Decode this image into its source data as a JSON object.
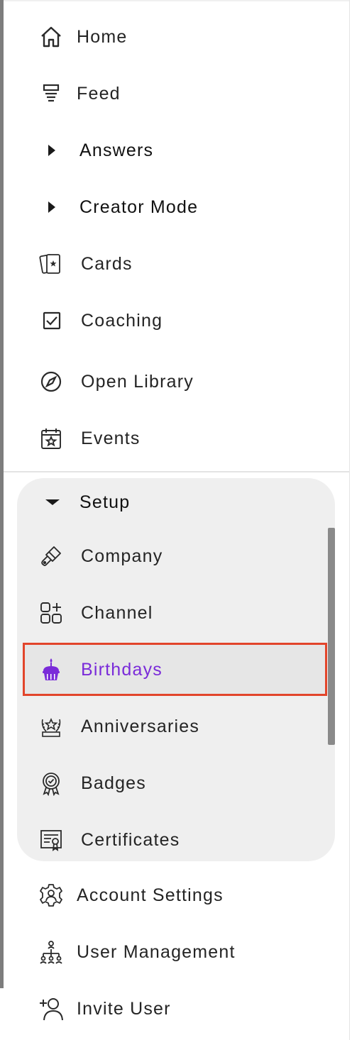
{
  "nav": {
    "home": {
      "label": "Home",
      "icon": "home-icon"
    },
    "feed": {
      "label": "Feed",
      "icon": "feed-icon"
    },
    "answers": {
      "label": "Answers",
      "icon": "caret-right-icon"
    },
    "creator_mode": {
      "label": "Creator Mode",
      "icon": "caret-right-icon"
    },
    "cards": {
      "label": "Cards",
      "icon": "cards-icon"
    },
    "coaching": {
      "label": "Coaching",
      "icon": "checkbox-icon"
    },
    "open_library": {
      "label": "Open Library",
      "icon": "compass-icon"
    },
    "events": {
      "label": "Events",
      "icon": "calendar-star-icon"
    }
  },
  "setup": {
    "label": "Setup",
    "expanded": true,
    "items": {
      "company": {
        "label": "Company",
        "icon": "paintbrush-icon"
      },
      "channel": {
        "label": "Channel",
        "icon": "grid-plus-icon"
      },
      "birthdays": {
        "label": "Birthdays",
        "icon": "cupcake-icon",
        "selected": true
      },
      "anniversaries": {
        "label": "Anniversaries",
        "icon": "laurel-star-icon"
      },
      "badges": {
        "label": "Badges",
        "icon": "badge-icon"
      },
      "certificates": {
        "label": "Certificates",
        "icon": "certificate-icon"
      }
    }
  },
  "bottom": {
    "account_settings": {
      "label": "Account Settings",
      "icon": "gear-user-icon"
    },
    "user_management": {
      "label": "User Management",
      "icon": "org-chart-icon"
    },
    "invite_user": {
      "label": "Invite User",
      "icon": "add-user-icon"
    }
  },
  "colors": {
    "selected": "#7a2bd9",
    "highlight_border": "#e2452b",
    "panel_bg": "#efefef"
  }
}
